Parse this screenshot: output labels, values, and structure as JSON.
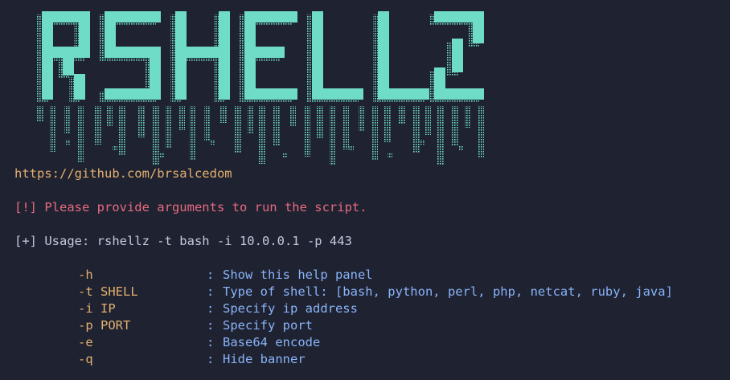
{
  "colors": {
    "background": "#1f2230",
    "banner": "#6fdcc8",
    "url": "#e3b071",
    "warning": "#e66b80",
    "text": "#c3c9df",
    "flag": "#e3b071",
    "description": "#89b4fa"
  },
  "banner": {
    "text": "RSHELLZ"
  },
  "terminal": {
    "url": "https://github.com/brsalcedom",
    "warning": "[!] Please provide arguments to run the script.",
    "usage": "[+] Usage: rshellz -t bash -i 10.0.0.1 -p 443",
    "separator": ":",
    "options": [
      {
        "flag": "-h",
        "description": "Show this help panel"
      },
      {
        "flag": "-t SHELL",
        "description": "Type of shell: [bash, python, perl, php, netcat, ruby, java]"
      },
      {
        "flag": "-i IP",
        "description": "Specify ip address"
      },
      {
        "flag": "-p PORT",
        "description": "Specify port"
      },
      {
        "flag": "-e",
        "description": "Base64 encode"
      },
      {
        "flag": "-q",
        "description": "Hide banner"
      }
    ]
  }
}
